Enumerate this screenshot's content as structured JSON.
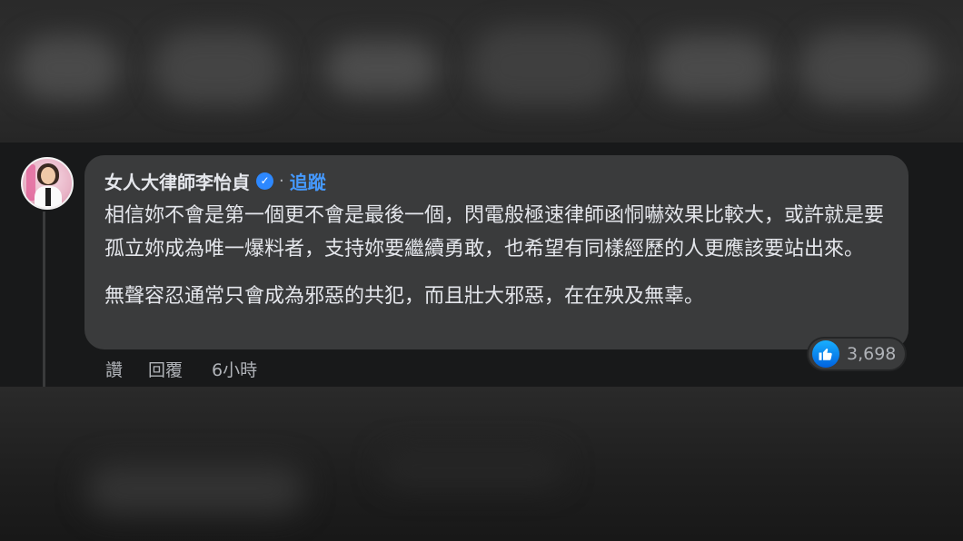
{
  "comment": {
    "author": "女人大律師李怡貞",
    "verified_icon": "verified-checkmark-icon",
    "separator": "·",
    "follow_label": "追蹤",
    "paragraphs": [
      "相信妳不會是第一個更不會是最後一個，閃電般極速律師函恫嚇效果比較大，或許就是要孤立妳成為唯一爆料者，支持妳要繼續勇敢，也希望有同樣經歷的人更應該要站出來。",
      "無聲容忍通常只會成為邪惡的共犯，而且壯大邪惡，在在殃及無辜。"
    ],
    "reaction_icon": "thumbs-up-icon",
    "reaction_count": "3,698",
    "actions": {
      "like_label": "讚",
      "reply_label": "回覆",
      "timestamp": "6小時"
    }
  },
  "colors": {
    "background": "#18191a",
    "bubble": "#3a3b3c",
    "link": "#4599ff",
    "verified": "#2d88ff",
    "text": "#e4e6eb",
    "muted": "#b0b3b8"
  }
}
